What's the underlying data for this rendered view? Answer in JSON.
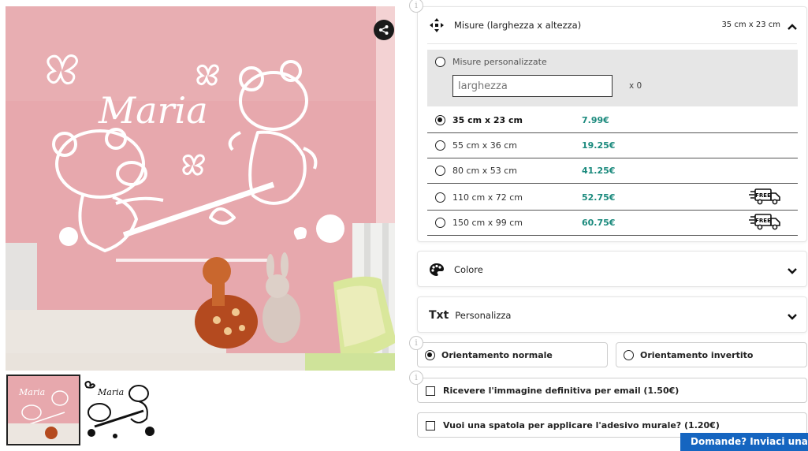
{
  "gallery": {
    "main_image_name": "Maria",
    "thumb_text": "Maria",
    "share_icon": "share-icon"
  },
  "size_panel": {
    "title": "Misure (larghezza x altezza)",
    "selected_value": "35 cm x 23 cm",
    "icon": "move-arrows-icon",
    "expanded": true,
    "custom": {
      "label": "Misure personalizzate",
      "width_placeholder": "larghezza",
      "height_value": "x 0"
    },
    "options": [
      {
        "size": "35 cm x 23 cm",
        "price": "7.99€",
        "selected": true,
        "free_shipping": false
      },
      {
        "size": "55 cm x 36 cm",
        "price": "19.25€",
        "selected": false,
        "free_shipping": false
      },
      {
        "size": "80 cm x 53 cm",
        "price": "41.25€",
        "selected": false,
        "free_shipping": false
      },
      {
        "size": "110 cm x 72 cm",
        "price": "52.75€",
        "selected": false,
        "free_shipping": true
      },
      {
        "size": "150 cm x 99 cm",
        "price": "60.75€",
        "selected": false,
        "free_shipping": true
      }
    ],
    "free_badge_text": "FREE"
  },
  "color_panel": {
    "title": "Colore",
    "icon": "palette-icon"
  },
  "text_panel": {
    "title": "Personalizza",
    "icon_text": "Txt"
  },
  "orientation": {
    "normal": "Orientamento normale",
    "inverted": "Orientamento invertito",
    "selected": "normal"
  },
  "extras": {
    "email_image": "Ricevere l'immagine definitiva per email (1.50€)",
    "spatula": "Vuoi una spatola per applicare l'adesivo murale? (1.20€)"
  },
  "contact_button": "Domande? Inviaci una E-mail",
  "info_glyph": "i",
  "colors": {
    "wall": "#e8a9ae",
    "price": "#1b8a7d",
    "contact": "#1565c0"
  }
}
